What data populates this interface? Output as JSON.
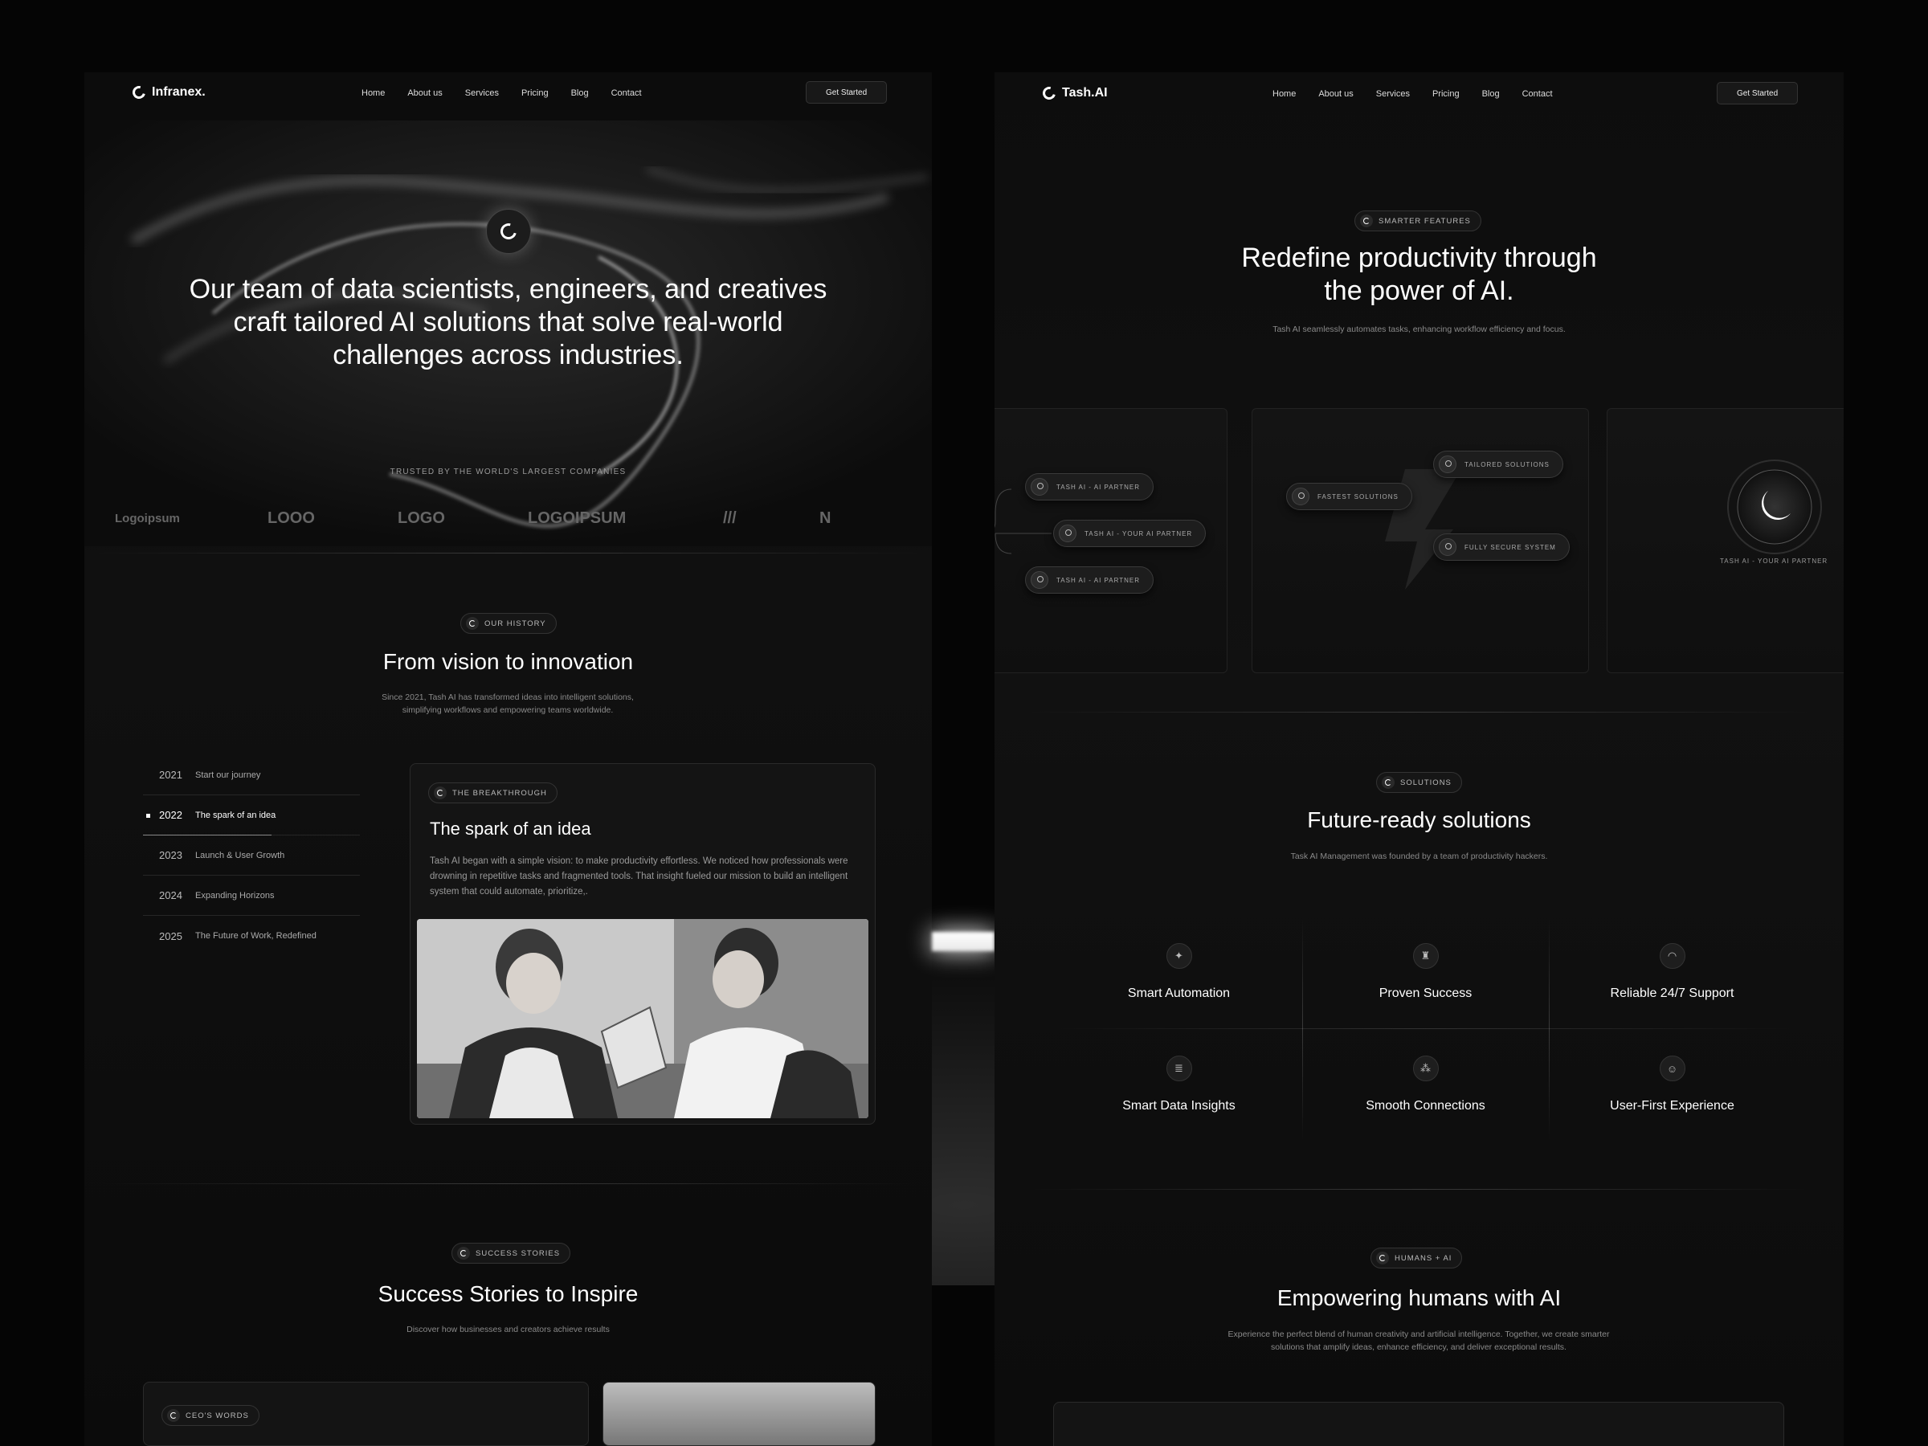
{
  "left": {
    "brand": "Infranex.",
    "nav": [
      "Home",
      "About us",
      "Services",
      "Pricing",
      "Blog",
      "Contact"
    ],
    "cta": "Get Started",
    "hero_title": "Our team of data scientists, engineers, and creatives craft tailored AI solutions that solve real-world challenges across industries.",
    "trusted": "TRUSTED BY THE WORLD'S LARGEST COMPANIES",
    "logos": [
      "Logoipsum",
      "LOOO",
      "LOGO",
      "LOGOIPSUM",
      "///",
      "N"
    ],
    "history": {
      "pill": "OUR HISTORY",
      "title": "From vision to innovation",
      "subtitle": "Since 2021, Tash AI has transformed ideas into intelligent solutions, simplifying workflows and empowering teams worldwide.",
      "timeline": [
        {
          "year": "2021",
          "label": "Start our journey"
        },
        {
          "year": "2022",
          "label": "The spark of an idea"
        },
        {
          "year": "2023",
          "label": "Launch & User Growth"
        },
        {
          "year": "2024",
          "label": "Expanding Horizons"
        },
        {
          "year": "2025",
          "label": "The Future of Work, Redefined"
        }
      ],
      "active_year": "2022",
      "card": {
        "pill": "THE BREAKTHROUGH",
        "title": "The spark of an idea",
        "body": "Tash AI began with a simple vision: to make productivity effortless. We noticed how professionals were drowning in repetitive tasks and fragmented tools. That insight fueled our mission to build an intelligent system that could automate, prioritize,."
      }
    },
    "stories": {
      "pill": "SUCCESS STORIES",
      "title": "Success Stories to Inspire",
      "subtitle": "Discover how businesses and creators achieve results",
      "ceo_pill": "CEO'S WORDS"
    }
  },
  "right": {
    "brand": "Tash.AI",
    "nav": [
      "Home",
      "About us",
      "Services",
      "Pricing",
      "Blog",
      "Contact"
    ],
    "cta": "Get Started",
    "features": {
      "pill": "SMARTER FEATURES",
      "title_line1": "Redefine productivity through",
      "title_line2": "the power of AI.",
      "subtitle": "Tash AI seamlessly automates tasks, enhancing workflow efficiency and focus.",
      "chips_left": [
        "TASH AI - AI PARTNER",
        "TASH AI - YOUR AI PARTNER",
        "TASH AI - AI PARTNER"
      ],
      "chips_mid": [
        "TAILORED SOLUTIONS",
        "FASTEST SOLUTIONS",
        "FULLY SECURE SYSTEM"
      ],
      "orb_label": "TASH AI - YOUR AI PARTNER"
    },
    "solutions": {
      "pill": "SOLUTIONS",
      "title": "Future-ready solutions",
      "subtitle": "Task AI Management was founded by a team of productivity hackers.",
      "items": [
        {
          "label": "Smart Automation",
          "icon": "lightbulb-icon"
        },
        {
          "label": "Proven Success",
          "icon": "trophy-icon"
        },
        {
          "label": "Reliable 24/7 Support",
          "icon": "headset-icon"
        },
        {
          "label": "Smart Data Insights",
          "icon": "database-icon"
        },
        {
          "label": "Smooth Connections",
          "icon": "nodes-icon"
        },
        {
          "label": "User-First Experience",
          "icon": "user-icon"
        }
      ]
    },
    "humans": {
      "pill": "HUMANS + AI",
      "title": "Empowering humans with AI",
      "subtitle": "Experience the perfect blend of human creativity and artificial intelligence. Together, we create smarter solutions that amplify ideas, enhance efficiency, and deliver exceptional results."
    }
  }
}
